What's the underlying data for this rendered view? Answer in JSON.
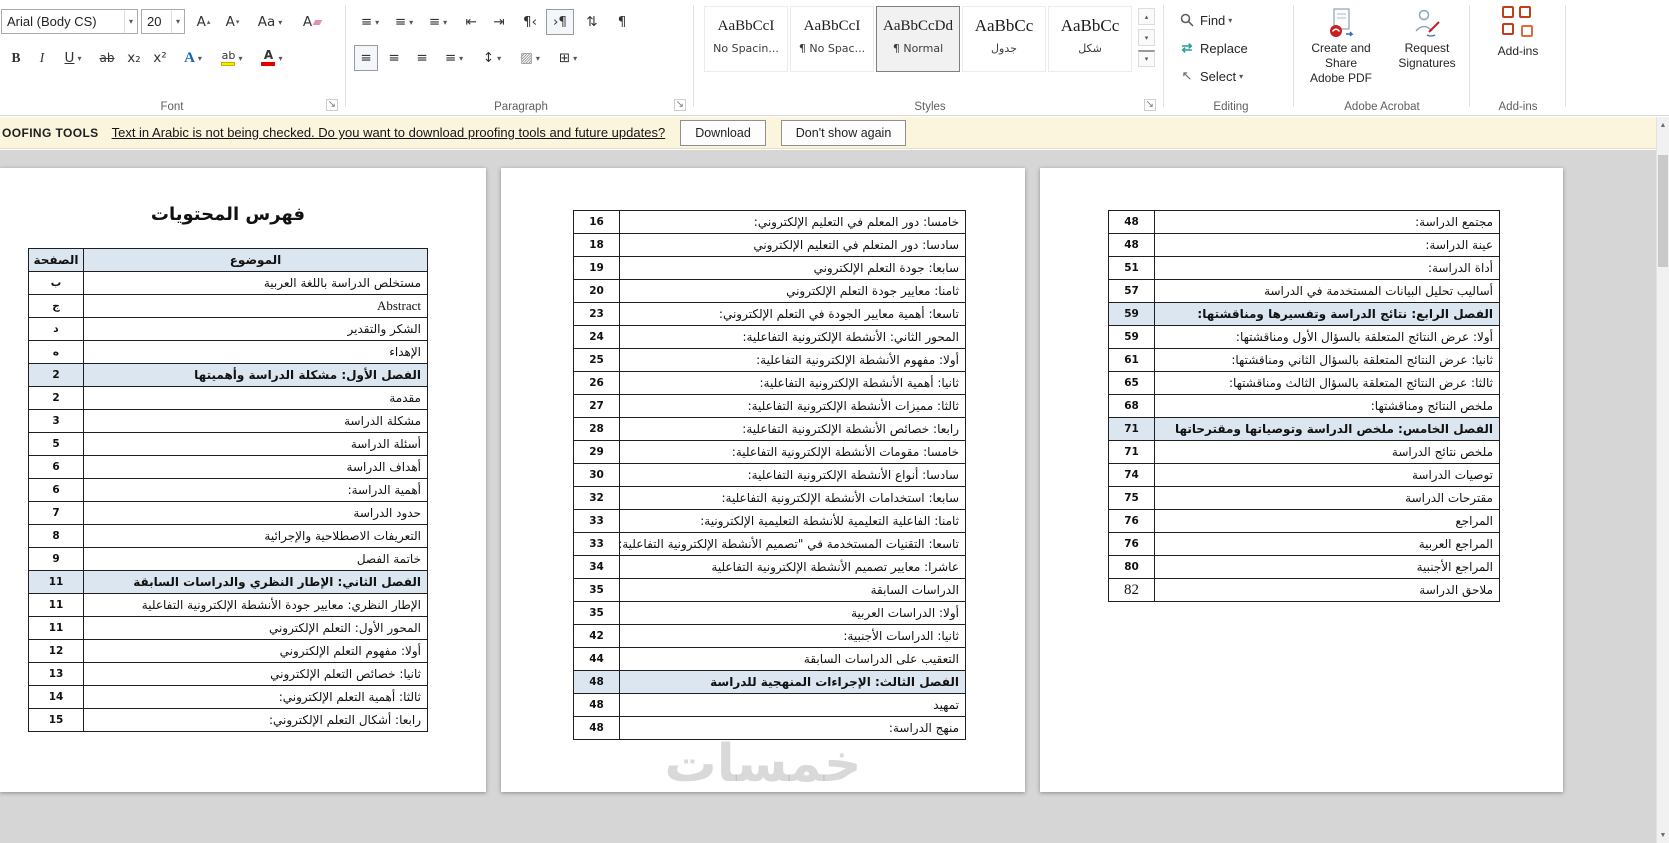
{
  "icons": {
    "caret": "▾",
    "caret_up": "▴",
    "bullets": "≡",
    "numbering": "≡",
    "multilevel": "≡",
    "outdent": "⇤",
    "indent": "⇥",
    "ltr": "¶‹",
    "rtl": "›¶",
    "sort": "⇅",
    "pilcrow": "¶",
    "align": "≡",
    "line_spacing": "↕",
    "shading": "▨",
    "borders": "⊞",
    "select": "↖",
    "replace": "⇄",
    "more": "▾",
    "scroll_up": "▲",
    "scroll_down": "▼",
    "launcher": "↘"
  },
  "ribbon": {
    "font_group": {
      "label": "Font",
      "font_name": "Arial (Body CS)",
      "font_size": "20",
      "grow": "A",
      "shrink": "A",
      "change_case": "Aa",
      "clear": "A",
      "bold": "B",
      "italic": "I",
      "underline": "U",
      "strike": "ab",
      "sub": "x₂",
      "sup": "x²",
      "effects": "A",
      "highlight": "ab",
      "color": "A"
    },
    "paragraph_group": {
      "label": "Paragraph"
    },
    "styles_group": {
      "label": "Styles",
      "items": [
        {
          "preview": "AaBbCcI",
          "name": "No Spacin..."
        },
        {
          "preview": "AaBbCcI",
          "name": "¶ No Spac..."
        },
        {
          "preview": "AaBbCcDd",
          "name": "¶ Normal"
        },
        {
          "preview": "AaBbCc",
          "name": "جدول"
        },
        {
          "preview": "AaBbCc",
          "name": "شكل"
        }
      ]
    },
    "editing_group": {
      "label": "Editing",
      "find": "Find",
      "replace": "Replace",
      "select": "Select"
    },
    "acrobat_group": {
      "label": "Adobe Acrobat",
      "create_line1": "Create and Share",
      "create_line2": "Adobe PDF",
      "request_line1": "Request",
      "request_line2": "Signatures"
    },
    "addins_group": {
      "label": "Add-ins",
      "button": "Add-ins"
    }
  },
  "proofing_bar": {
    "prefix": "OOFING TOOLS",
    "message": "Text in Arabic is not being checked. Do you want to download proofing tools and future updates?",
    "download": "Download",
    "dismiss": "Don't show again"
  },
  "document": {
    "watermark": "خمسات",
    "page1": {
      "title": "فهرس المحتويات",
      "col_page": "الصفحة",
      "col_topic": "الموضوع",
      "rows": [
        {
          "p": "ب",
          "t": "مستخلص الدراسة باللغة العربية"
        },
        {
          "p": "ج",
          "t": "Abstract",
          "en": true
        },
        {
          "p": "د",
          "t": "الشكر والتقدير"
        },
        {
          "p": "ه",
          "t": "الإهداء"
        },
        {
          "p": "2",
          "t": "الفصل الأول: مشكلة الدراسة وأهميتها",
          "hl": true
        },
        {
          "p": "2",
          "t": "مقدمة"
        },
        {
          "p": "3",
          "t": "مشكلة الدراسة"
        },
        {
          "p": "5",
          "t": "أسئلة الدراسة"
        },
        {
          "p": "6",
          "t": "أهداف الدراسة"
        },
        {
          "p": "6",
          "t": "أهمية الدراسة:"
        },
        {
          "p": "7",
          "t": "حدود الدراسة"
        },
        {
          "p": "8",
          "t": "التعريفات الاصطلاحية والإجرائية"
        },
        {
          "p": "9",
          "t": "خاتمة الفصل"
        },
        {
          "p": "11",
          "t": "الفصل الثاني: الإطار النظري والدراسات السابقة",
          "hl": true
        },
        {
          "p": "11",
          "t": "الإطار النظري: معايير جودة الأنشطة الإلكترونية التفاعلية"
        },
        {
          "p": "11",
          "t": "المحور الأول: التعلم الإلكتروني"
        },
        {
          "p": "12",
          "t": "أولا: مفهوم التعلم الإلكتروني"
        },
        {
          "p": "13",
          "t": "ثانيا: خصائص التعلم الإلكتروني"
        },
        {
          "p": "14",
          "t": "ثالثا: أهمية التعلم الإلكتروني:"
        },
        {
          "p": "15",
          "t": "رابعا: أشكال التعلم الإلكتروني:"
        }
      ]
    },
    "page2": {
      "rows": [
        {
          "p": "16",
          "t": "خامسا: دور المعلم في التعليم الإلكتروني:"
        },
        {
          "p": "18",
          "t": "سادسا: دور المتعلم في التعليم الإلكتروني"
        },
        {
          "p": "19",
          "t": "سابعا: جودة التعلم الإلكتروني"
        },
        {
          "p": "20",
          "t": "ثامنا: معايير جودة التعلم الإلكتروني"
        },
        {
          "p": "23",
          "t": "تاسعا: أهمية معايير الجودة في التعلم الإلكتروني:"
        },
        {
          "p": "24",
          "t": "المحور الثاني: الأنشطة الإلكترونية التفاعلية:"
        },
        {
          "p": "25",
          "t": "أولا: مفهوم الأنشطة الإلكترونية التفاعلية:"
        },
        {
          "p": "26",
          "t": "ثانيا: أهمية الأنشطة الإلكترونية التفاعلية:"
        },
        {
          "p": "27",
          "t": "ثالثا: مميزات الأنشطة الإلكترونية التفاعلية:"
        },
        {
          "p": "28",
          "t": "رابعا: خصائص الأنشطة الإلكترونية التفاعلية:"
        },
        {
          "p": "29",
          "t": "خامسا: مقومات الأنشطة الإلكترونية التفاعلية:"
        },
        {
          "p": "30",
          "t": "سادسا: أنواع الأنشطة الإلكترونية التفاعلية:"
        },
        {
          "p": "32",
          "t": "سابعا: استخدامات الأنشطة الإلكترونية التفاعلية:"
        },
        {
          "p": "33",
          "t": "ثامنا: الفاعلية التعليمية للأنشطة التعليمية الإلكترونية:"
        },
        {
          "p": "33",
          "t": "تاسعا: التقنيات المستخدمة في \"تصميم الأنشطة الإلكترونية التفاعلية:"
        },
        {
          "p": "34",
          "t": "عاشرا: معايير تصميم الأنشطة الإلكترونية التفاعلية"
        },
        {
          "p": "35",
          "t": "الدراسات السابقة"
        },
        {
          "p": "35",
          "t": "أولا: الدراسات العربية"
        },
        {
          "p": "42",
          "t": "ثانيا: الدراسات الأجنبية:"
        },
        {
          "p": "44",
          "t": "التعقيب على الدراسات السابقة"
        },
        {
          "p": "48",
          "t": "الفصل الثالث: الإجراءات المنهجية للدراسة",
          "hl": true
        },
        {
          "p": "48",
          "t": "تمهيد"
        },
        {
          "p": "48",
          "t": "منهج الدراسة:"
        }
      ]
    },
    "page3": {
      "rows": [
        {
          "p": "48",
          "t": "مجتمع الدراسة:"
        },
        {
          "p": "48",
          "t": "عينة الدراسة:"
        },
        {
          "p": "51",
          "t": "أداة الدراسة:"
        },
        {
          "p": "57",
          "t": "أساليب تحليل البيانات المستخدمة في الدراسة"
        },
        {
          "p": "59",
          "t": "الفصل الرابع: نتائج الدراسة وتفسيرها ومناقشتها:",
          "hl": true
        },
        {
          "p": "59",
          "t": "أولا: عرض النتائج المتعلقة بالسؤال الأول ومناقشتها:"
        },
        {
          "p": "61",
          "t": "ثانيا: عرض النتائج المتعلقة بالسؤال الثاني ومناقشتها:"
        },
        {
          "p": "65",
          "t": "ثالثا: عرض النتائج المتعلقة بالسؤال الثالث ومناقشتها:"
        },
        {
          "p": "68",
          "t": "ملخص النتائج ومناقشتها:"
        },
        {
          "p": "71",
          "t": "الفصل الخامس: ملخص الدراسة وتوصياتها ومقترحاتها",
          "hl": true
        },
        {
          "p": "71",
          "t": "ملخص نتائج الدراسة"
        },
        {
          "p": "74",
          "t": "توصيات الدراسة"
        },
        {
          "p": "75",
          "t": "مقترحات الدراسة"
        },
        {
          "p": "76",
          "t": "المراجع"
        },
        {
          "p": "76",
          "t": "المراجع العربية"
        },
        {
          "p": "80",
          "t": "المراجع الأجنبية"
        },
        {
          "p": "82",
          "t": "ملاحق الدراسة",
          "big": true
        }
      ]
    }
  }
}
